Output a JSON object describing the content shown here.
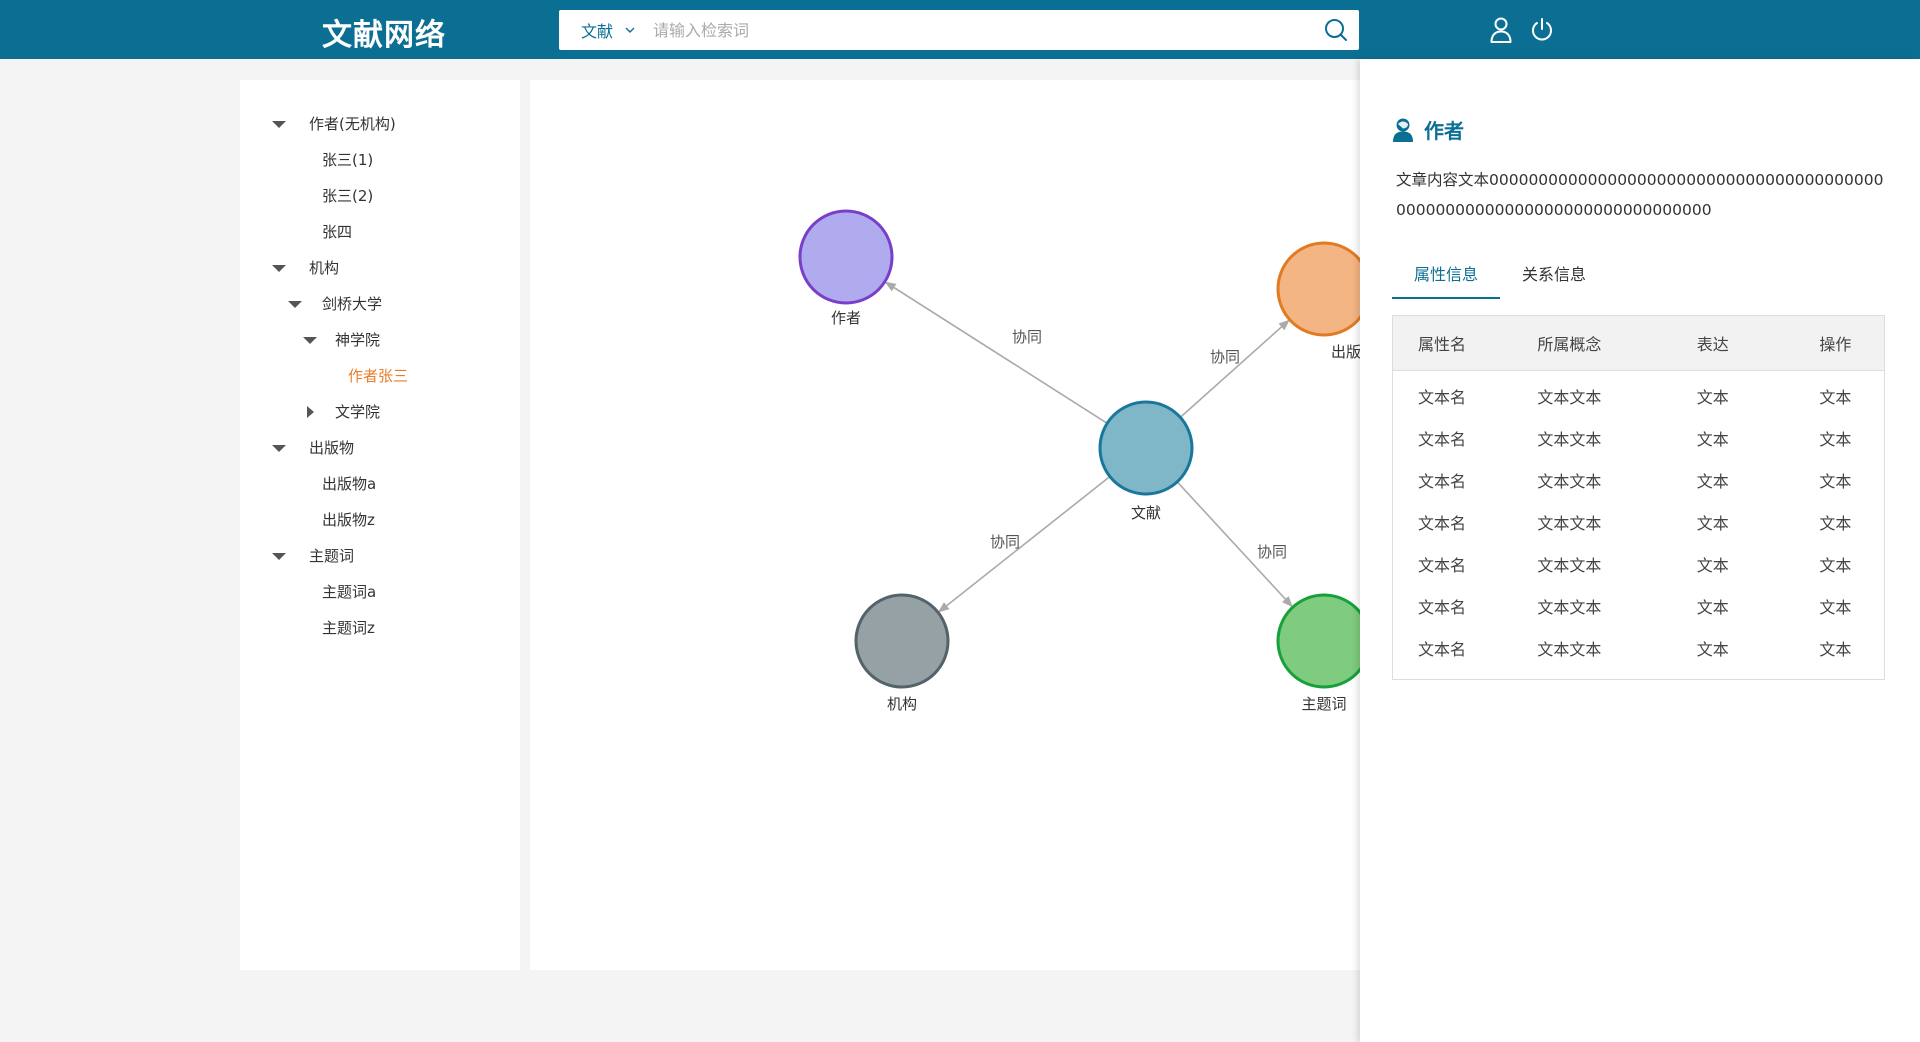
{
  "header": {
    "logo": "文献网络",
    "search_type": "文献",
    "search_placeholder": "请输入检索词"
  },
  "tree": [
    {
      "label": "作者(无机构)",
      "level": 0,
      "toggle": "expanded"
    },
    {
      "label": "张三(1)",
      "level": 1,
      "toggle": "none"
    },
    {
      "label": "张三(2)",
      "level": 1,
      "toggle": "none"
    },
    {
      "label": "张四",
      "level": 1,
      "toggle": "none"
    },
    {
      "label": "机构",
      "level": 0,
      "toggle": "expanded"
    },
    {
      "label": "剑桥大学",
      "level": 1,
      "toggle": "expanded"
    },
    {
      "label": "神学院",
      "level": 2,
      "toggle": "expanded"
    },
    {
      "label": "作者张三",
      "level": 3,
      "toggle": "none",
      "selected": true
    },
    {
      "label": "文学院",
      "level": 2,
      "toggle": "collapsed"
    },
    {
      "label": "出版物",
      "level": 0,
      "toggle": "expanded"
    },
    {
      "label": "出版物a",
      "level": 1,
      "toggle": "none"
    },
    {
      "label": "出版物z",
      "level": 1,
      "toggle": "none"
    },
    {
      "label": "主题词",
      "level": 0,
      "toggle": "expanded"
    },
    {
      "label": "主题词a",
      "level": 1,
      "toggle": "none"
    },
    {
      "label": "主题词z",
      "level": 1,
      "toggle": "none"
    }
  ],
  "graph": {
    "nodes": [
      {
        "id": "author",
        "label": "作者",
        "fill": "#b0aaee",
        "stroke": "#7a3fc8"
      },
      {
        "id": "publication",
        "label": "出版",
        "fill": "#f4b584",
        "stroke": "#e27a22"
      },
      {
        "id": "literature",
        "label": "文献",
        "fill": "#7fb7c9",
        "stroke": "#1a779c"
      },
      {
        "id": "institution",
        "label": "机构",
        "fill": "#96a1a6",
        "stroke": "#54626a"
      },
      {
        "id": "keyword",
        "label": "主题词",
        "fill": "#7fcb7f",
        "stroke": "#16a13a"
      }
    ],
    "edges": [
      {
        "from": "literature",
        "to": "author",
        "label": "协同"
      },
      {
        "from": "literature",
        "to": "publication",
        "label": "协同"
      },
      {
        "from": "literature",
        "to": "institution",
        "label": "协同"
      },
      {
        "from": "literature",
        "to": "keyword",
        "label": "协同"
      }
    ]
  },
  "panel": {
    "title": "作者",
    "description": "文章内容文本000000000000000000000000000000000000000000000000000000000000000000000000",
    "tabs": [
      {
        "label": "属性信息",
        "active": true
      },
      {
        "label": "关系信息",
        "active": false
      }
    ],
    "table": {
      "headers": [
        "属性名",
        "所属概念",
        "表达",
        "操作"
      ],
      "rows": [
        [
          "文本名",
          "文本文本",
          "文本",
          "文本"
        ],
        [
          "文本名",
          "文本文本",
          "文本",
          "文本"
        ],
        [
          "文本名",
          "文本文本",
          "文本",
          "文本"
        ],
        [
          "文本名",
          "文本文本",
          "文本",
          "文本"
        ],
        [
          "文本名",
          "文本文本",
          "文本",
          "文本"
        ],
        [
          "文本名",
          "文本文本",
          "文本",
          "文本"
        ],
        [
          "文本名",
          "文本文本",
          "文本",
          "文本"
        ]
      ]
    }
  },
  "colors": {
    "brand": "#0b6f94",
    "selected": "#e87e2a"
  },
  "icons": {
    "search": "search-icon",
    "dropdown": "chevron-down-icon",
    "user": "user-icon",
    "power": "power-icon",
    "panel_title": "person-icon"
  }
}
